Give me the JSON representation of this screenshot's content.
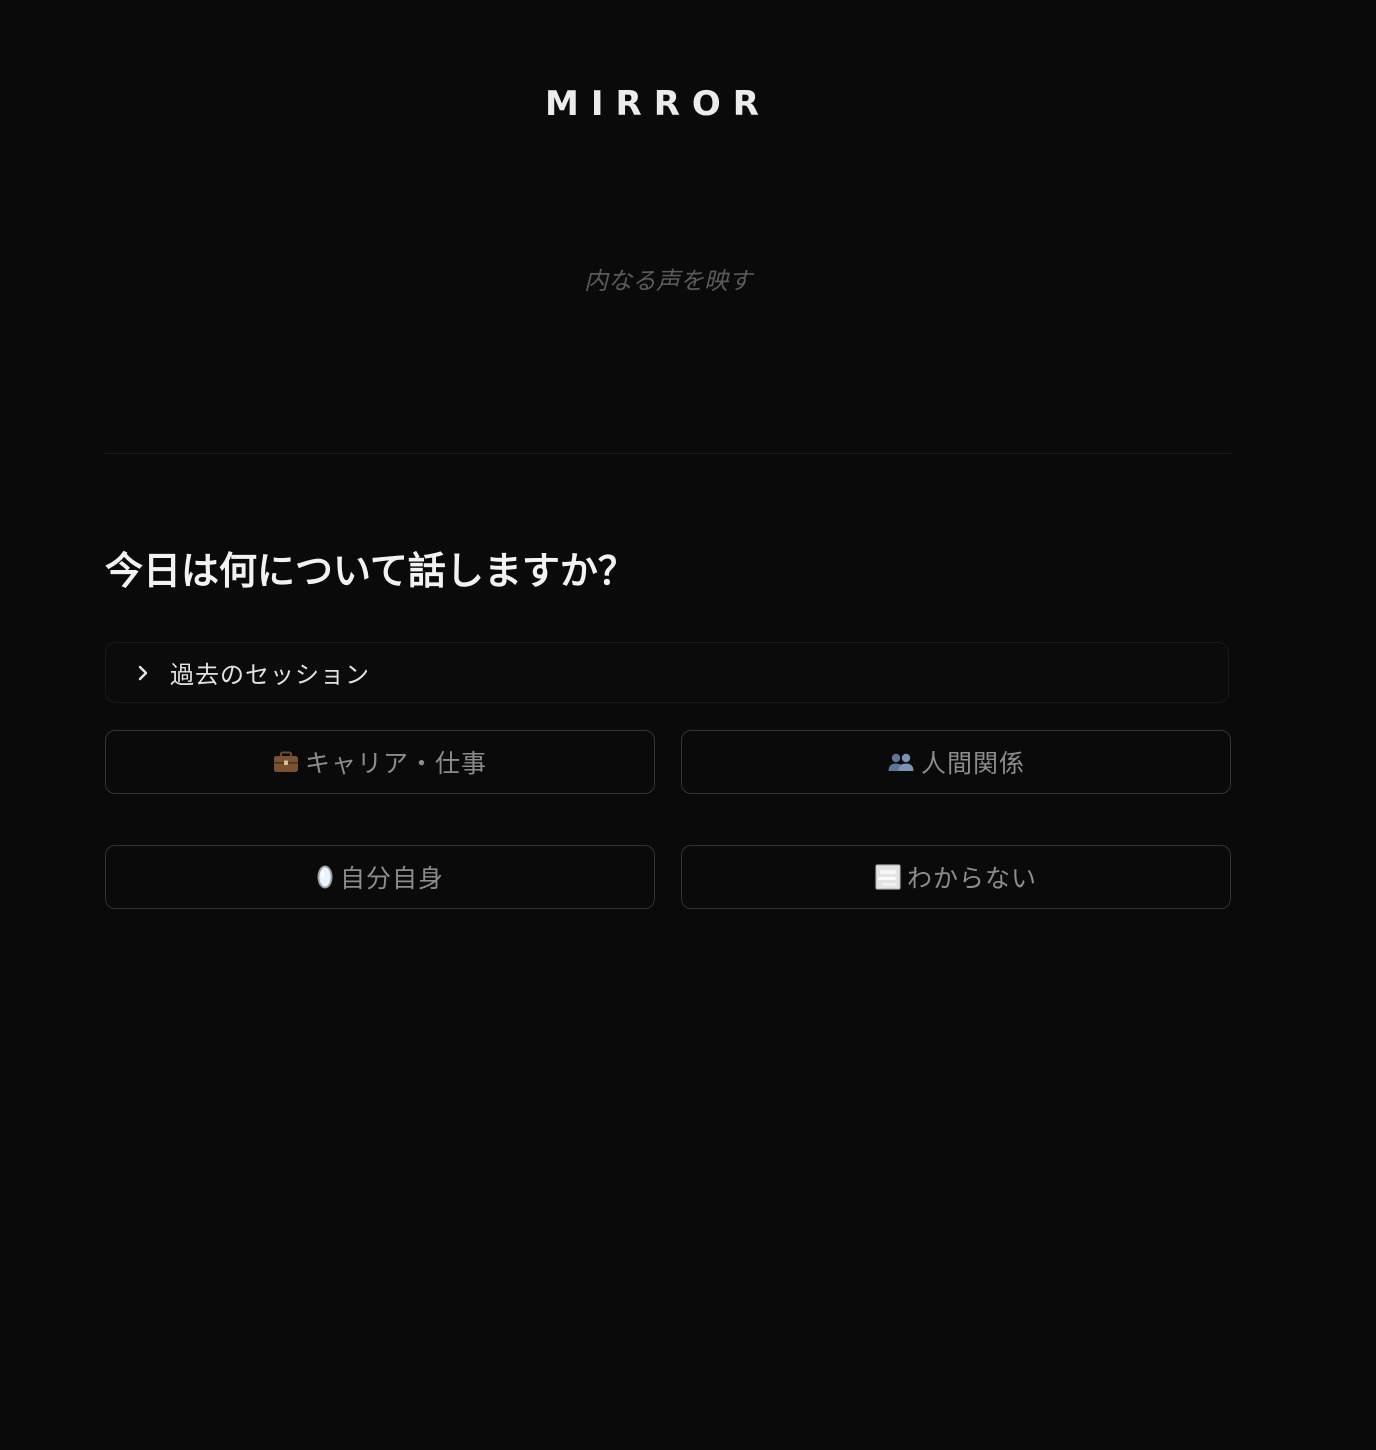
{
  "header": {
    "brand": "MIRROR",
    "tagline": "内なる声を映す"
  },
  "main": {
    "prompt": "今日は何について話しますか？",
    "history": {
      "label": "過去のセッション",
      "icon": "chevron-right-icon"
    },
    "topics": [
      {
        "label": "キャリア・仕事",
        "icon": "briefcase-icon"
      },
      {
        "label": "人間関係",
        "icon": "people-icon"
      },
      {
        "label": "自分自身",
        "icon": "mirror-icon"
      },
      {
        "label": "わからない",
        "icon": "fog-icon"
      }
    ]
  },
  "colors": {
    "background": "#0a0a0a",
    "text_primary": "#ececec",
    "text_muted": "#8c8c8c",
    "border": "#333333"
  }
}
